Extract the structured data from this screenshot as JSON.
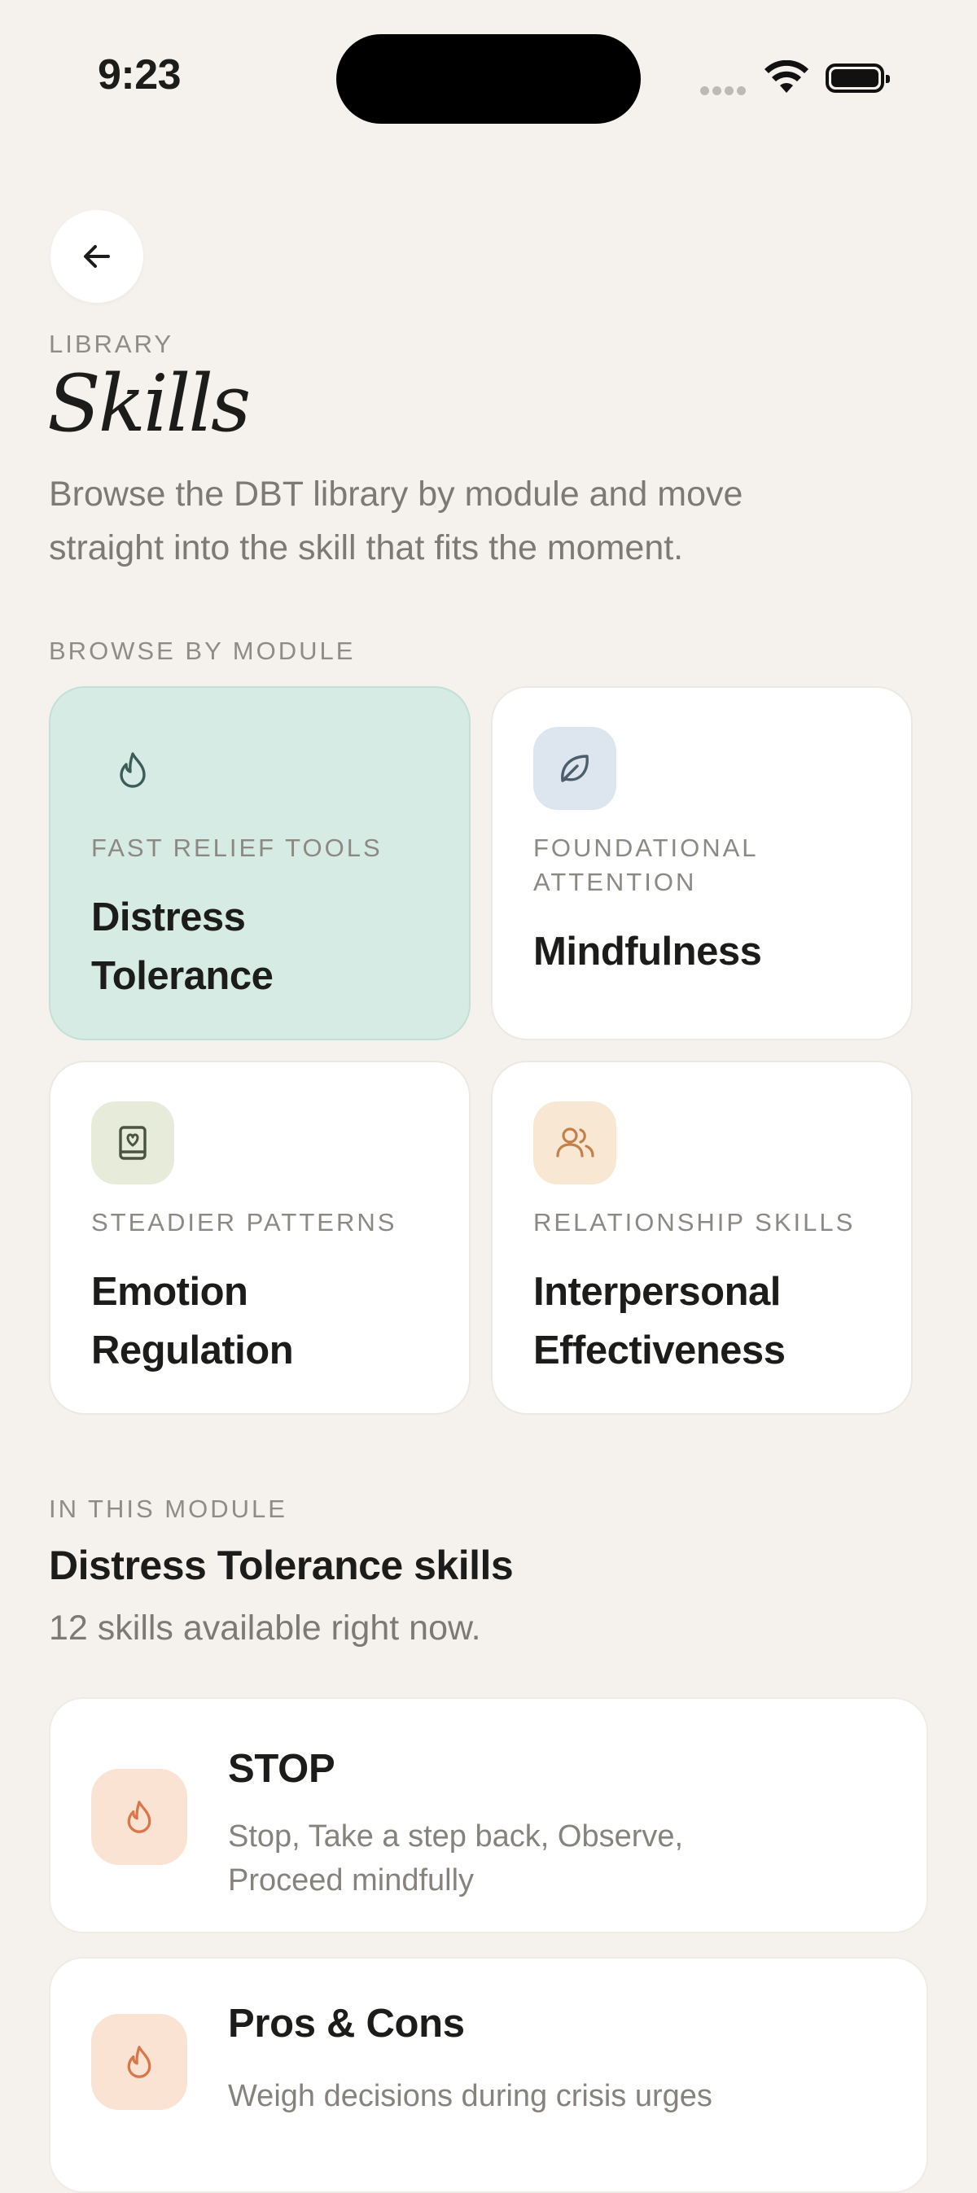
{
  "status_bar": {
    "time": "9:23"
  },
  "header": {
    "eyebrow": "LIBRARY",
    "title": "Skills",
    "intro": "Browse the DBT library by module and move straight into the skill that fits the moment."
  },
  "modules": {
    "heading": "BROWSE BY MODULE",
    "items": [
      {
        "kicker": "FAST RELIEF TOOLS",
        "name": "Distress Tolerance",
        "icon": "flame-icon",
        "selected": true
      },
      {
        "kicker": "FOUNDATIONAL ATTENTION",
        "name": "Mindfulness",
        "icon": "leaf-icon",
        "selected": false
      },
      {
        "kicker": "STEADIER PATTERNS",
        "name": "Emotion Regulation",
        "icon": "journal-heart-icon",
        "selected": false
      },
      {
        "kicker": "RELATIONSHIP SKILLS",
        "name": "Interpersonal Effectiveness",
        "icon": "people-icon",
        "selected": false
      }
    ]
  },
  "module_detail": {
    "eyebrow": "IN THIS MODULE",
    "heading": "Distress Tolerance skills",
    "count_text": "12 skills available right now."
  },
  "skills": [
    {
      "title": "STOP",
      "desc": "Stop, Take a step back, Observe, Proceed mindfully",
      "icon": "flame-icon"
    },
    {
      "title": "Pros & Cons",
      "desc": "Weigh decisions during crisis urges",
      "icon": "flame-icon"
    }
  ],
  "colors": {
    "background": "#f5f2ed",
    "selected_card": "#d7ebe5",
    "mindfulness_tile": "#dde6ee",
    "emotion_tile": "#e6ecd9",
    "interpersonal_tile": "#f8e7d3",
    "skill_tile": "#fbe3d4",
    "accent_orange": "#d9774a"
  }
}
